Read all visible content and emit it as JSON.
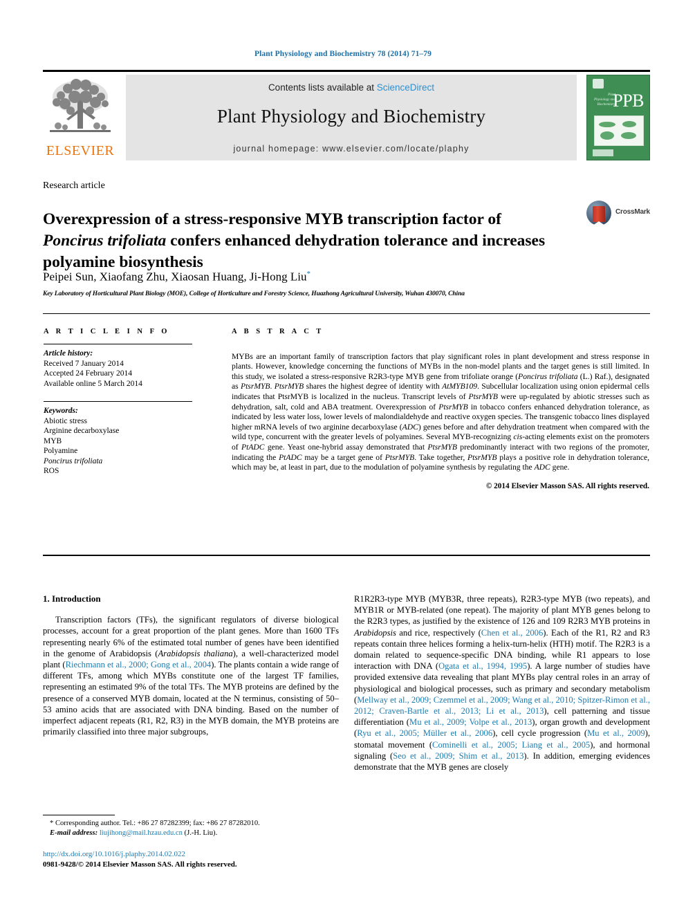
{
  "running_head": "Plant Physiology and Biochemistry 78 (2014) 71–79",
  "masthead": {
    "publisher_name": "ELSEVIER",
    "contents_prefix": "Contents lists available at ",
    "sciencedirect": "ScienceDirect",
    "journal_title": "Plant Physiology and Biochemistry",
    "homepage": "journal homepage: www.elsevier.com/locate/plaphy",
    "cover_acronym": "PPB",
    "cover_subtitle": "Plant Physiology and Biochemistry",
    "link_color": "#2f8fd0",
    "cover_color": "#3f8f55",
    "elsevier_orange": "#e87511"
  },
  "article": {
    "type": "Research article",
    "title_line1": "Overexpression of a stress-responsive MYB transcription factor of",
    "title_italic": "Poncirus trifoliata",
    "title_line2_rest": " confers enhanced dehydration tolerance and",
    "title_line3": "increases polyamine biosynthesis",
    "authors": "Peipei Sun, Xiaofang Zhu, Xiaosan Huang, Ji-Hong Liu",
    "author_marker": "*",
    "affiliation": "Key Laboratory of Horticultural Plant Biology (MOE), College of Horticulture and Forestry Science, Huazhong Agricultural University, Wuhan 430070, China",
    "crossmark_label": "CrossMark"
  },
  "article_info": {
    "heading": "A R T I C L E  I N F O",
    "history_label": "Article history:",
    "history": [
      "Received 7 January 2014",
      "Accepted 24 February 2014",
      "Available online 5 March 2014"
    ],
    "keywords_label": "Keywords:",
    "keywords": [
      "Abiotic stress",
      "Arginine decarboxylase",
      "MYB",
      "Polyamine",
      "Poncirus trifoliata",
      "ROS"
    ],
    "keyword_italic_index": 4
  },
  "abstract": {
    "heading": "A B S T R A C T",
    "p1_a": "MYBs are an important family of transcription factors that play significant roles in plant development and stress response in plants. However, knowledge concerning the functions of MYBs in the non-model plants and the target genes is still limited. In this study, we isolated a stress-responsive R2R3-type MYB gene from trifoliate orange (",
    "p1_sp": "Poncirus trifoliata",
    "p1_b": " (L.) Raf.), designated as ",
    "p1_g1": "PtsrMYB",
    "p1_c": ". ",
    "p1_g2": "PtsrMYB",
    "p1_d": " shares the highest degree of identity with ",
    "p1_g3": "AtMYB109",
    "p1_e": ". Subcellular localization using onion epidermal cells indicates that PtsrMYB is localized in the nucleus. Transcript levels of ",
    "p1_g4": "PtsrMYB",
    "p1_f": " were up-regulated by abiotic stresses such as dehydration, salt, cold and ABA treatment. Overexpression of ",
    "p1_g5": "PtsrMYB",
    "p1_h": " in tobacco confers enhanced dehydration tolerance, as indicated by less water loss, lower levels of malondialdehyde and reactive oxygen species. The transgenic tobacco lines displayed higher mRNA levels of two arginine decarboxylase (",
    "p1_g6": "ADC",
    "p1_i": ") genes before and after dehydration treatment when compared with the wild type, concurrent with the greater levels of polyamines. Several MYB-recognizing ",
    "p1_g7": "cis",
    "p1_j": "-acting elements exist on the promoters of ",
    "p1_g8": "PtADC",
    "p1_k": " gene. Yeast one-hybrid assay demonstrated that ",
    "p1_g9": "PtsrMYB",
    "p1_l": " predominantly interact with two regions of the promoter, indicating the ",
    "p1_g10": "PtADC",
    "p1_m": " may be a target gene of ",
    "p1_g11": "PtsrMYB",
    "p1_n": ". Take together, ",
    "p1_g12": "PtsrMYB",
    "p1_o": " plays a positive role in dehydration tolerance, which may be, at least in part, due to the modulation of polyamine synthesis by regulating the ",
    "p1_g13": "ADC",
    "p1_p": " gene.",
    "copyright": "© 2014 Elsevier Masson SAS. All rights reserved."
  },
  "body": {
    "section_number_title": "1.  Introduction",
    "left_a": "Transcription factors (TFs), the significant regulators of diverse biological processes, account for a great proportion of the plant genes. More than 1600 TFs representing nearly 6% of the estimated total number of genes have been identified in the genome of Arabidopsis (",
    "left_it1": "Arabidopsis thaliana",
    "left_b": "), a well-characterized model plant (",
    "left_ref1": "Riechmann et al., 2000; Gong et al., 2004",
    "left_c": "). The plants contain a wide range of different TFs, among which MYBs constitute one of the largest TF families, representing an estimated 9% of the total TFs. The MYB proteins are defined by the presence of a conserved MYB domain, located at the N terminus, consisting of 50–53 amino acids that are associated with DNA binding. Based on the number of imperfect adjacent repeats (R1, R2, R3) in the MYB domain, the MYB proteins are primarily classified into three major subgroups,",
    "right_a": "R1R2R3-type MYB (MYB3R, three repeats), R2R3-type MYB (two repeats), and MYB1R or MYB-related (one repeat). The majority of plant MYB genes belong to the R2R3 types, as justified by the existence of 126 and 109 R2R3 MYB proteins in ",
    "right_it1": "Arabidopsis",
    "right_b": " and rice, respectively (",
    "right_ref1": "Chen et al., 2006",
    "right_c": "). Each of the R1, R2 and R3 repeats contain three helices forming a helix-turn-helix (HTH) motif. The R2R3 is a domain related to sequence-specific DNA binding, while R1 appears to lose interaction with DNA (",
    "right_ref2": "Ogata et al., 1994, 1995",
    "right_d": "). A large number of studies have provided extensive data revealing that plant MYBs play central roles in an array of physiological and biological processes, such as primary and secondary metabolism (",
    "right_ref3": "Mellway et al., 2009; Czemmel et al., 2009; Wang et al., 2010; Spitzer-Rimon et al., 2012; Craven-Bartle et al., 2013; Li et al., 2013",
    "right_e": "), cell patterning and tissue differentiation (",
    "right_ref4": "Mu et al., 2009; Volpe et al., 2013",
    "right_f": "), organ growth and development (",
    "right_ref5": "Ryu et al., 2005; Müller et al., 2006",
    "right_g": "), cell cycle progression (",
    "right_ref6": "Mu et al., 2009",
    "right_h": "), stomatal movement (",
    "right_ref7": "Cominelli et al., 2005; Liang et al., 2005",
    "right_i": "), and hormonal signaling (",
    "right_ref8": "Seo et al., 2009; Shim et al., 2013",
    "right_j": "). In addition, emerging evidences demonstrate that the MYB genes are closely"
  },
  "footnote": {
    "corresponding": "* Corresponding author. Tel.: +86 27 87282399; fax: +86 27 87282010.",
    "email_label": "E-mail address:",
    "email": "liujihong@mail.hzau.edu.cn",
    "email_suffix": " (J.-H. Liu)."
  },
  "doi_block": {
    "doi": "http://dx.doi.org/10.1016/j.plaphy.2014.02.022",
    "issn": "0981-9428/© 2014 Elsevier Masson SAS. All rights reserved."
  },
  "colors": {
    "header_blue": "#1a6fa8",
    "reference_blue": "#1a7bb0"
  }
}
